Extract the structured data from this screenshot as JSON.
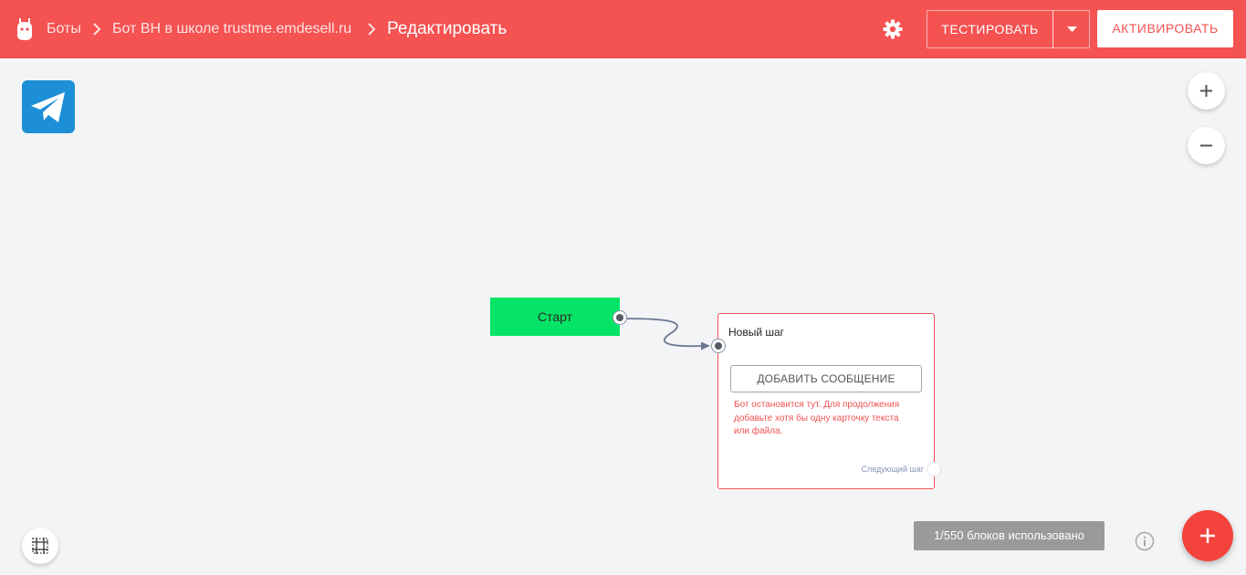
{
  "breadcrumb": {
    "items": [
      {
        "label": "Боты"
      },
      {
        "label": "Бот ВН в школе trustme.emdesell.ru"
      }
    ],
    "current": "Редактировать"
  },
  "toolbar": {
    "test_label": "ТЕСТИРОВАТЬ",
    "activate_label": "АКТИВИРОВАТЬ",
    "settings_icon": "gear-icon",
    "dropdown_icon": "caret-down-icon"
  },
  "canvas": {
    "channel_icon": "telegram-icon",
    "zoom_in_icon": "plus-icon",
    "zoom_out_icon": "minus-icon",
    "start_node": {
      "label": "Старт"
    },
    "step_node": {
      "title": "Новый шаг",
      "add_message_label": "ДОБАВИТЬ СООБЩЕНИЕ",
      "warning": "Бот остановится тут. Для продолжения добавьте хотя бы одну карточку текста или файла.",
      "next_step_label": "Следующий шаг"
    }
  },
  "footer": {
    "usage_label": "1/550 блоков использовано",
    "grid_icon": "grid-align-icon",
    "info_icon": "info-icon",
    "add_icon": "plus-icon"
  },
  "colors": {
    "header": "#f55252",
    "start_node": "#05e466",
    "telegram": "#1c8fd6",
    "fab": "#f4423c",
    "warning": "#f05252"
  }
}
